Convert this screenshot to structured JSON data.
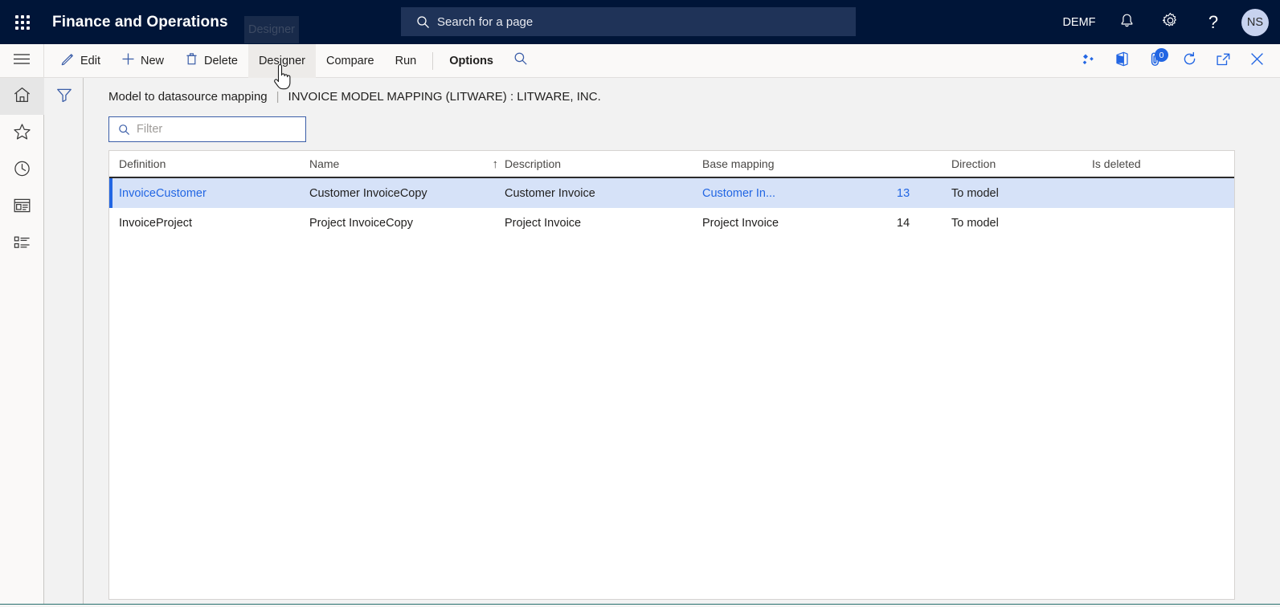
{
  "topnav": {
    "app_launcher_icon": "waffle-grid-icon",
    "app_title": "Finance and Operations",
    "search": {
      "icon": "search-icon",
      "placeholder": "Search for a page"
    },
    "company": "DEMF",
    "notifications_icon": "bell-icon",
    "settings_icon": "gear-icon",
    "help_icon": "question-mark-icon",
    "avatar_initials": "NS",
    "ghost_tooltip": "Designer"
  },
  "actionpane": {
    "hamburger_icon": "hamburger-icon",
    "buttons": [
      {
        "label": "Edit",
        "icon": "pencil-icon",
        "state": "normal"
      },
      {
        "label": "New",
        "icon": "plus-icon",
        "state": "normal"
      },
      {
        "label": "Delete",
        "icon": "trash-icon",
        "state": "normal"
      },
      {
        "label": "Designer",
        "icon": "",
        "state": "hovered"
      },
      {
        "label": "Compare",
        "icon": "",
        "state": "normal"
      },
      {
        "label": "Run",
        "icon": "",
        "state": "normal"
      },
      {
        "label": "Options",
        "icon": "",
        "state": "bold"
      }
    ],
    "search_icon": "search-icon",
    "right_icons": [
      {
        "name": "personalize-diamonds-icon",
        "badge": ""
      },
      {
        "name": "office-app-icon",
        "badge": ""
      },
      {
        "name": "attachment-icon",
        "badge": "0"
      },
      {
        "name": "refresh-icon",
        "badge": ""
      },
      {
        "name": "open-in-new-window-icon",
        "badge": ""
      },
      {
        "name": "close-icon",
        "badge": ""
      }
    ]
  },
  "rail": {
    "items": [
      {
        "name": "home-icon",
        "active": true
      },
      {
        "name": "favorites-star-icon",
        "active": false
      },
      {
        "name": "recent-clock-icon",
        "active": false
      },
      {
        "name": "workspaces-icon",
        "active": false
      },
      {
        "name": "modules-list-icon",
        "active": false
      }
    ]
  },
  "filterpane": {
    "icon": "filter-funnel-icon"
  },
  "content": {
    "breadcrumb": {
      "page": "Model to datasource mapping",
      "separator": "|",
      "context": "INVOICE MODEL MAPPING (LITWARE) : LITWARE, INC."
    },
    "filter": {
      "icon": "search-icon",
      "placeholder": "Filter",
      "value": ""
    },
    "grid": {
      "columns": [
        {
          "label": "Definition",
          "sorted": false
        },
        {
          "label": "Name",
          "sorted": true,
          "sort_direction": "ascending",
          "sort_glyph": "↑"
        },
        {
          "label": "Description",
          "sorted": false
        },
        {
          "label": "Base mapping",
          "sorted": false
        },
        {
          "label": "",
          "sorted": false
        },
        {
          "label": "Direction",
          "sorted": false
        },
        {
          "label": "Is deleted",
          "sorted": false
        }
      ],
      "rows": [
        {
          "selected": true,
          "definition": "InvoiceCustomer",
          "name": "Customer InvoiceCopy",
          "description": "Customer Invoice",
          "base_mapping": "Customer In...",
          "number": "13",
          "direction": "To model",
          "is_deleted": ""
        },
        {
          "selected": false,
          "definition": "InvoiceProject",
          "name": "Project InvoiceCopy",
          "description": "Project Invoice",
          "base_mapping": "Project Invoice",
          "number": "14",
          "direction": "To model",
          "is_deleted": ""
        }
      ]
    }
  },
  "colors": {
    "nav_bg": "#001538",
    "search_bg": "#1f3358",
    "accent_blue": "#2266e3",
    "row_selected_bg": "#d6e2f8",
    "pane_bg": "#faf9f8",
    "page_bg": "#f2f2f2",
    "bottom_accent": "#27706e"
  }
}
